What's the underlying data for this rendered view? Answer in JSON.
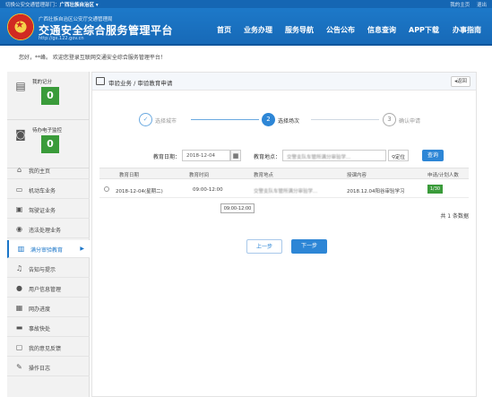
{
  "topbar": {
    "left_prefix": "切换公安交通管理部门：",
    "left_region": "广西壮族自治区 ▾",
    "right_home": "我的主页",
    "right_logout": "退出"
  },
  "header": {
    "org": "广西壮族自治区公安厅交通管理局",
    "title": "交通安全综合服务管理平台",
    "url": "http://gx.122.gov.cn",
    "nav": [
      "首页",
      "业务办理",
      "服务导航",
      "公告公布",
      "信息查询",
      "APP下载",
      "办事指南"
    ]
  },
  "greeting": "您好，**峰。 欢迎您登录互联网交通安全综合服务管理平台！",
  "sidebar": {
    "score_label": "我的记分",
    "score_value": "0",
    "violation_label": "待办电子监控",
    "violation_value": "0",
    "menu": [
      {
        "label": "我的主页",
        "icon": "home-icon"
      },
      {
        "label": "机动车业务",
        "icon": "car-icon"
      },
      {
        "label": "驾驶证业务",
        "icon": "license-icon"
      },
      {
        "label": "违法处理业务",
        "icon": "camera-icon"
      },
      {
        "label": "满分审验教育",
        "icon": "doc-icon"
      },
      {
        "label": "告知与提示",
        "icon": "bell-icon"
      },
      {
        "label": "用户信息管理",
        "icon": "user-icon"
      },
      {
        "label": "网办进度",
        "icon": "progress-icon"
      },
      {
        "label": "事故快处",
        "icon": "accident-icon"
      },
      {
        "label": "我的意见反馈",
        "icon": "feedback-icon"
      },
      {
        "label": "操作日志",
        "icon": "log-icon"
      }
    ]
  },
  "main": {
    "breadcrumb": "审验业务 / 审验教育申请",
    "back": "返回",
    "steps": [
      "选择城市",
      "选择场次",
      "确认申请"
    ],
    "filters": {
      "date_label": "教育日期：",
      "date_value": "2018-12-04",
      "place_label": "教育地点：",
      "place_value": "交警支队车管所满分审验学...",
      "locate": "定位",
      "query": "查询"
    },
    "table": {
      "headers": [
        "教育日期",
        "教育时间",
        "教育地点",
        "授课内容",
        "申请/计划人数"
      ],
      "rows": [
        {
          "date": "2018-12-04(星期二)",
          "time": "09:00-12:00",
          "place": "交警支队车管所满分审验学...",
          "content": "2018.12.04阳谷审验学习",
          "capacity": "1/30"
        }
      ],
      "tooltip": "09:00-12:00",
      "total": "共 1 条数据"
    },
    "prev": "上一步",
    "next": "下一步"
  },
  "colors": {
    "brand_blue": "#1769b7",
    "accent_blue": "#2d86d6",
    "green": "#3a9b3a"
  }
}
